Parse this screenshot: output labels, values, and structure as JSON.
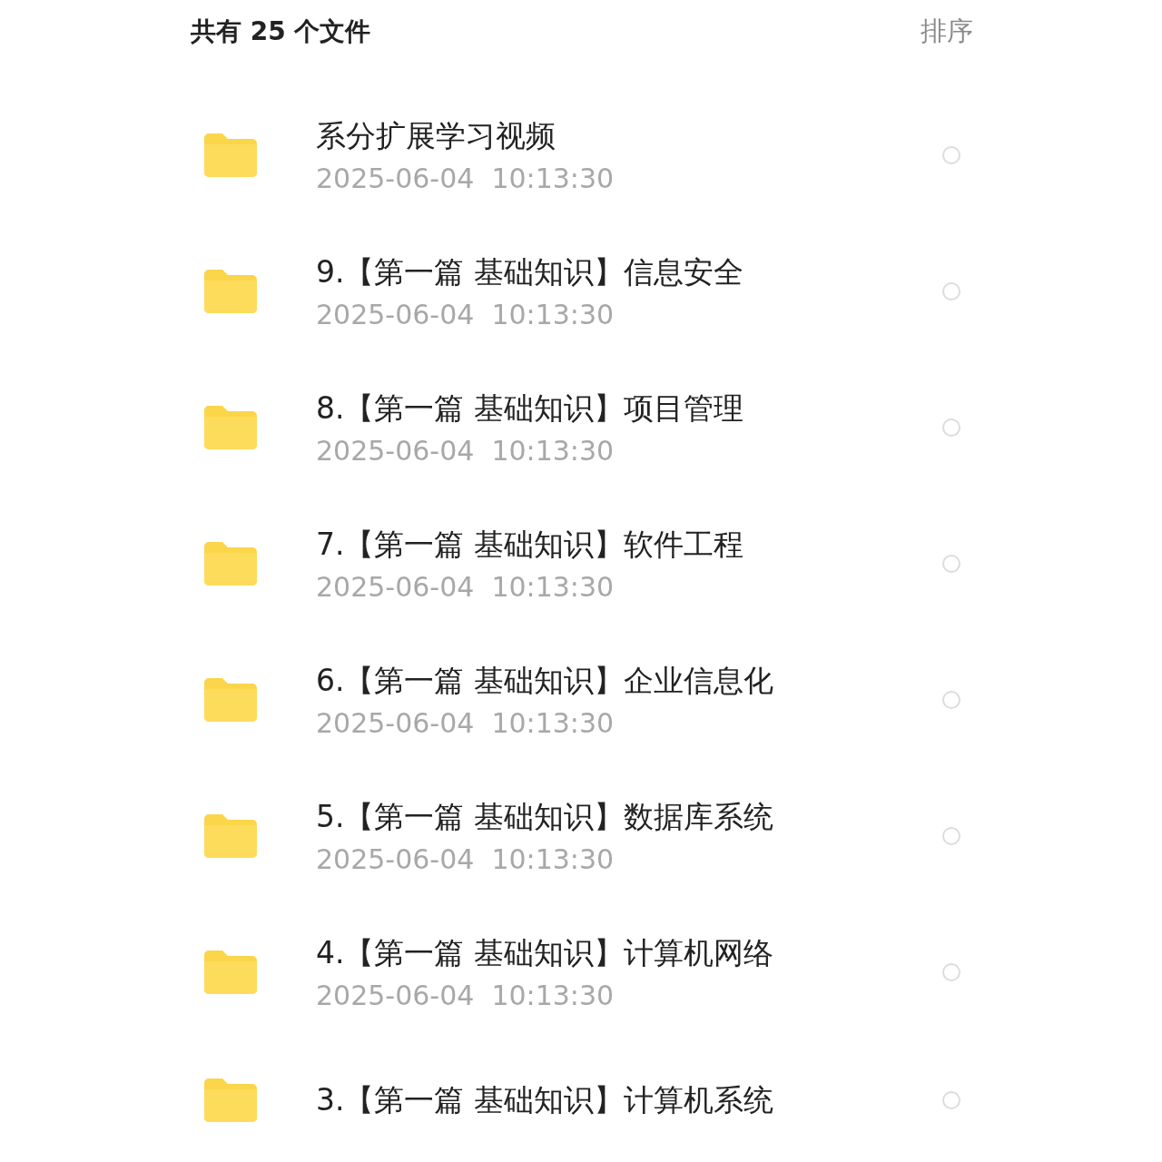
{
  "header": {
    "title": "共有 25 个文件",
    "sort_button": "排序"
  },
  "files": [
    {
      "kind": "folder",
      "name": "系分扩展学习视频",
      "modified": "2025-06-04  10:13:30",
      "selected": false
    },
    {
      "kind": "folder",
      "name": "9.【第一篇 基础知识】信息安全",
      "modified": "2025-06-04  10:13:30",
      "selected": false
    },
    {
      "kind": "folder",
      "name": "8.【第一篇 基础知识】项目管理",
      "modified": "2025-06-04  10:13:30",
      "selected": false
    },
    {
      "kind": "folder",
      "name": "7.【第一篇 基础知识】软件工程",
      "modified": "2025-06-04  10:13:30",
      "selected": false
    },
    {
      "kind": "folder",
      "name": "6.【第一篇 基础知识】企业信息化",
      "modified": "2025-06-04  10:13:30",
      "selected": false
    },
    {
      "kind": "folder",
      "name": "5.【第一篇 基础知识】数据库系统",
      "modified": "2025-06-04  10:13:30",
      "selected": false
    },
    {
      "kind": "folder",
      "name": "4.【第一篇 基础知识】计算机网络",
      "modified": "2025-06-04  10:13:30",
      "selected": false
    },
    {
      "kind": "folder",
      "name": "3.【第一篇 基础知识】计算机系统",
      "selected": false
    }
  ]
}
